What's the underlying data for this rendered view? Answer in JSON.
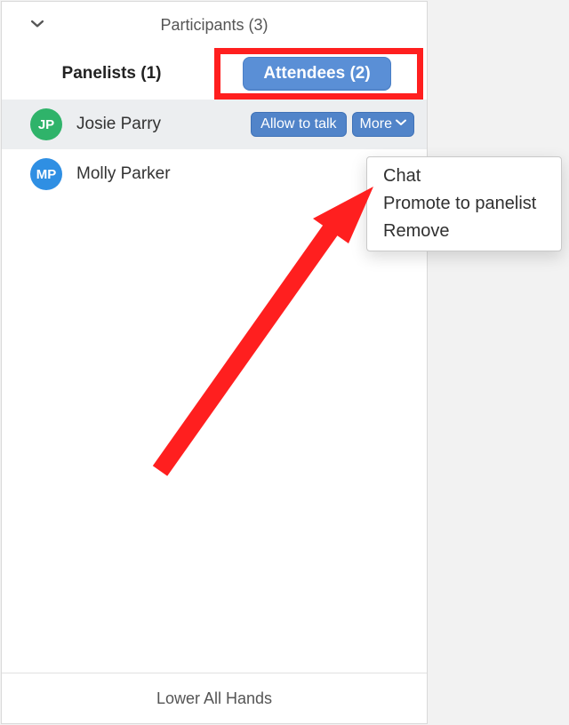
{
  "header": {
    "title": "Participants (3)"
  },
  "tabs": {
    "panelists_label": "Panelists (1)",
    "attendees_label": "Attendees (2)"
  },
  "attendees": [
    {
      "initials": "JP",
      "name": "Josie Parry",
      "avatar_color": "green"
    },
    {
      "initials": "MP",
      "name": "Molly Parker",
      "avatar_color": "blue"
    }
  ],
  "row_actions": {
    "allow_to_talk": "Allow to talk",
    "more": "More"
  },
  "more_menu": {
    "chat": "Chat",
    "promote": "Promote to panelist",
    "remove": "Remove"
  },
  "footer": {
    "lower_all_hands": "Lower All Hands"
  }
}
